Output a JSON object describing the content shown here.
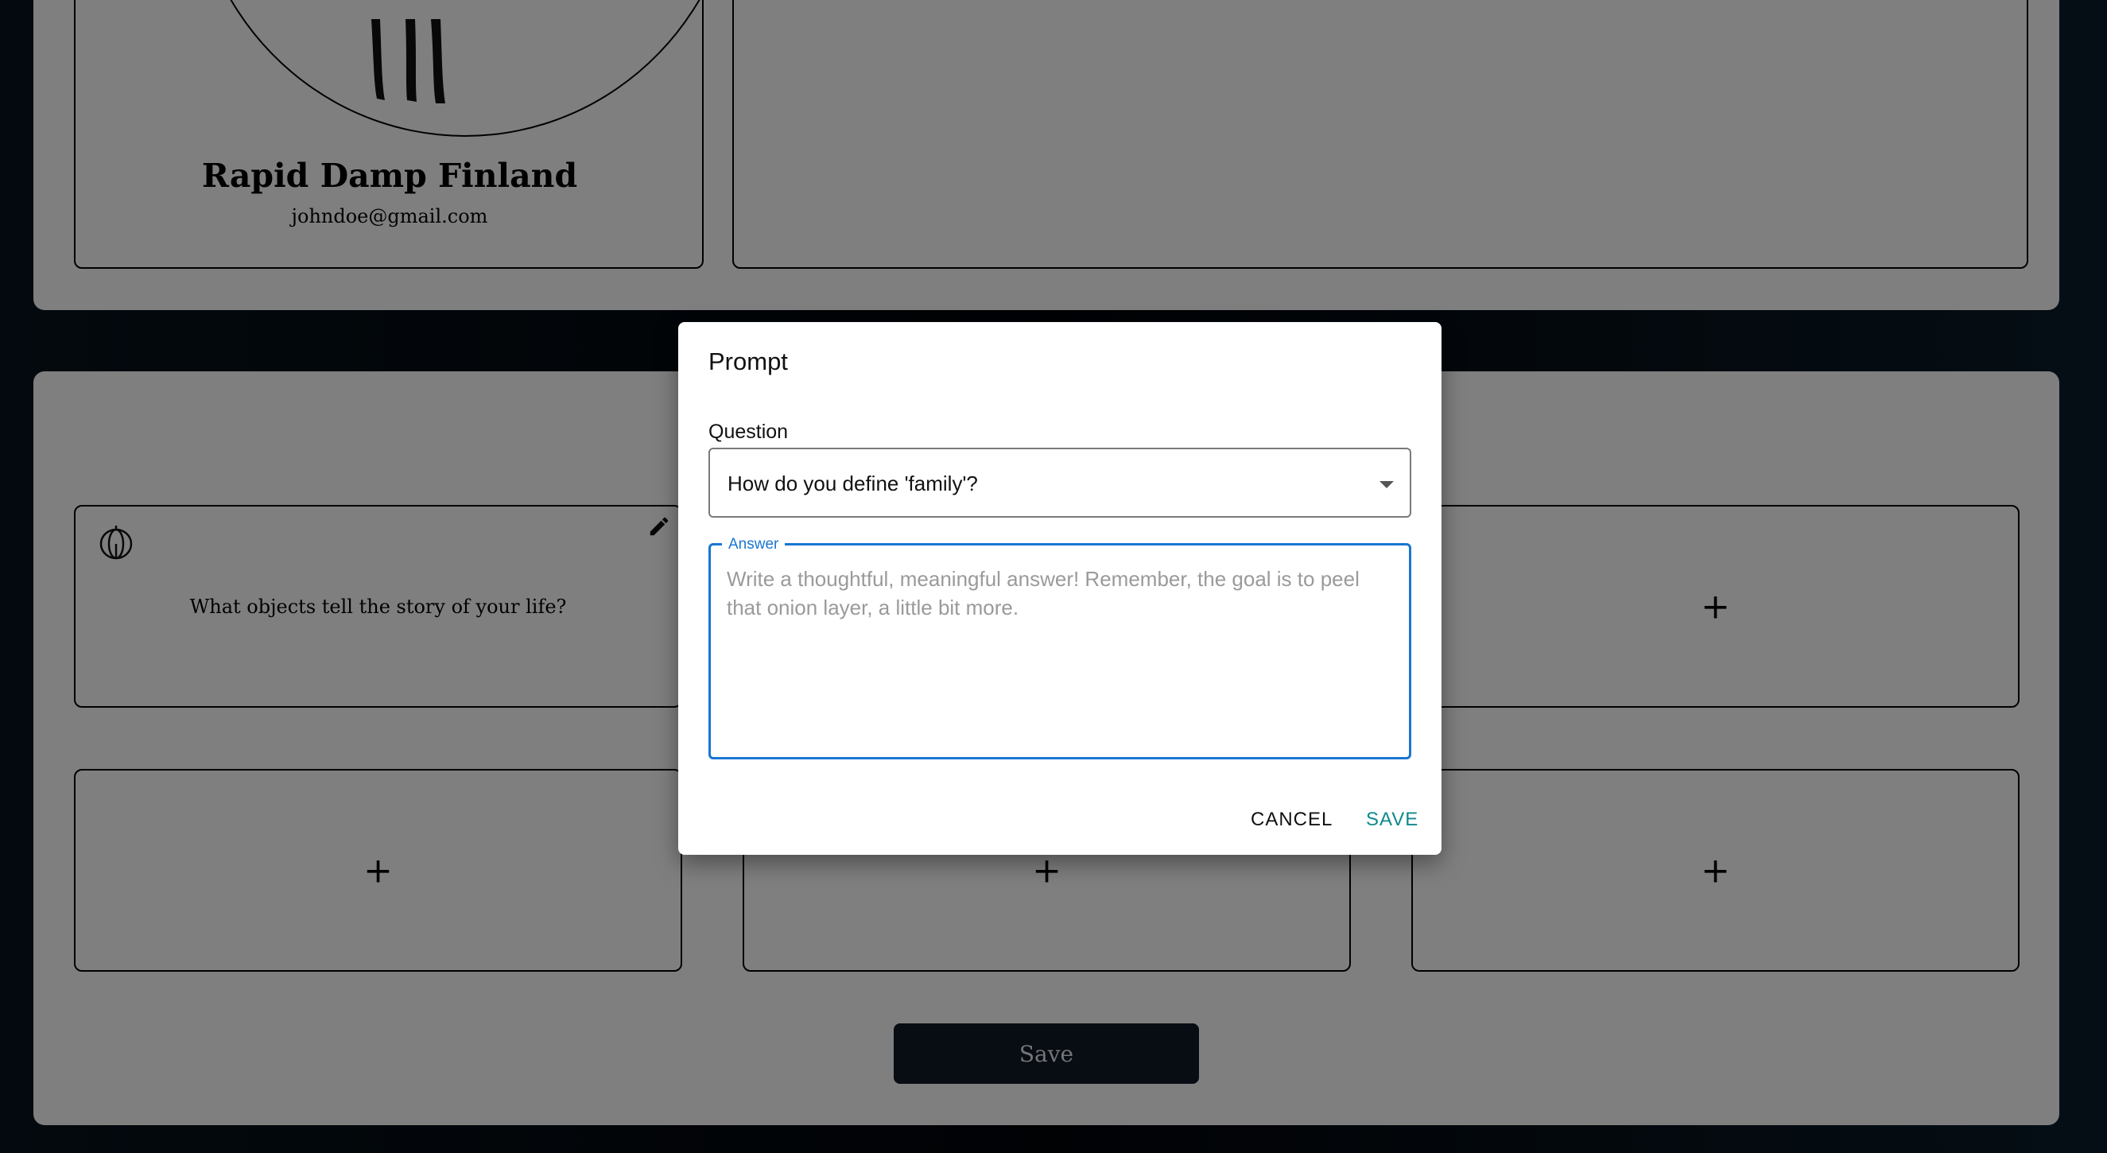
{
  "profile": {
    "name": "Rapid Damp Finland",
    "email": "johndoe@gmail.com"
  },
  "prompts": {
    "filled_question": "What objects tell the story of your life?",
    "empty_label": "+"
  },
  "page": {
    "save_label": "Save"
  },
  "dialog": {
    "title": "Prompt",
    "question_label": "Question",
    "question_value": "How do you define 'family'?",
    "answer_label": "Answer",
    "answer_value": "",
    "answer_placeholder": "Write a thoughtful, meaningful answer! Remember, the goal is to peel that onion layer, a little bit more.",
    "cancel_label": "CANCEL",
    "save_label": "SAVE"
  },
  "colors": {
    "accent_blue": "#1976d2",
    "save_teal": "#0f8a8a",
    "dark_button": "#101827"
  }
}
